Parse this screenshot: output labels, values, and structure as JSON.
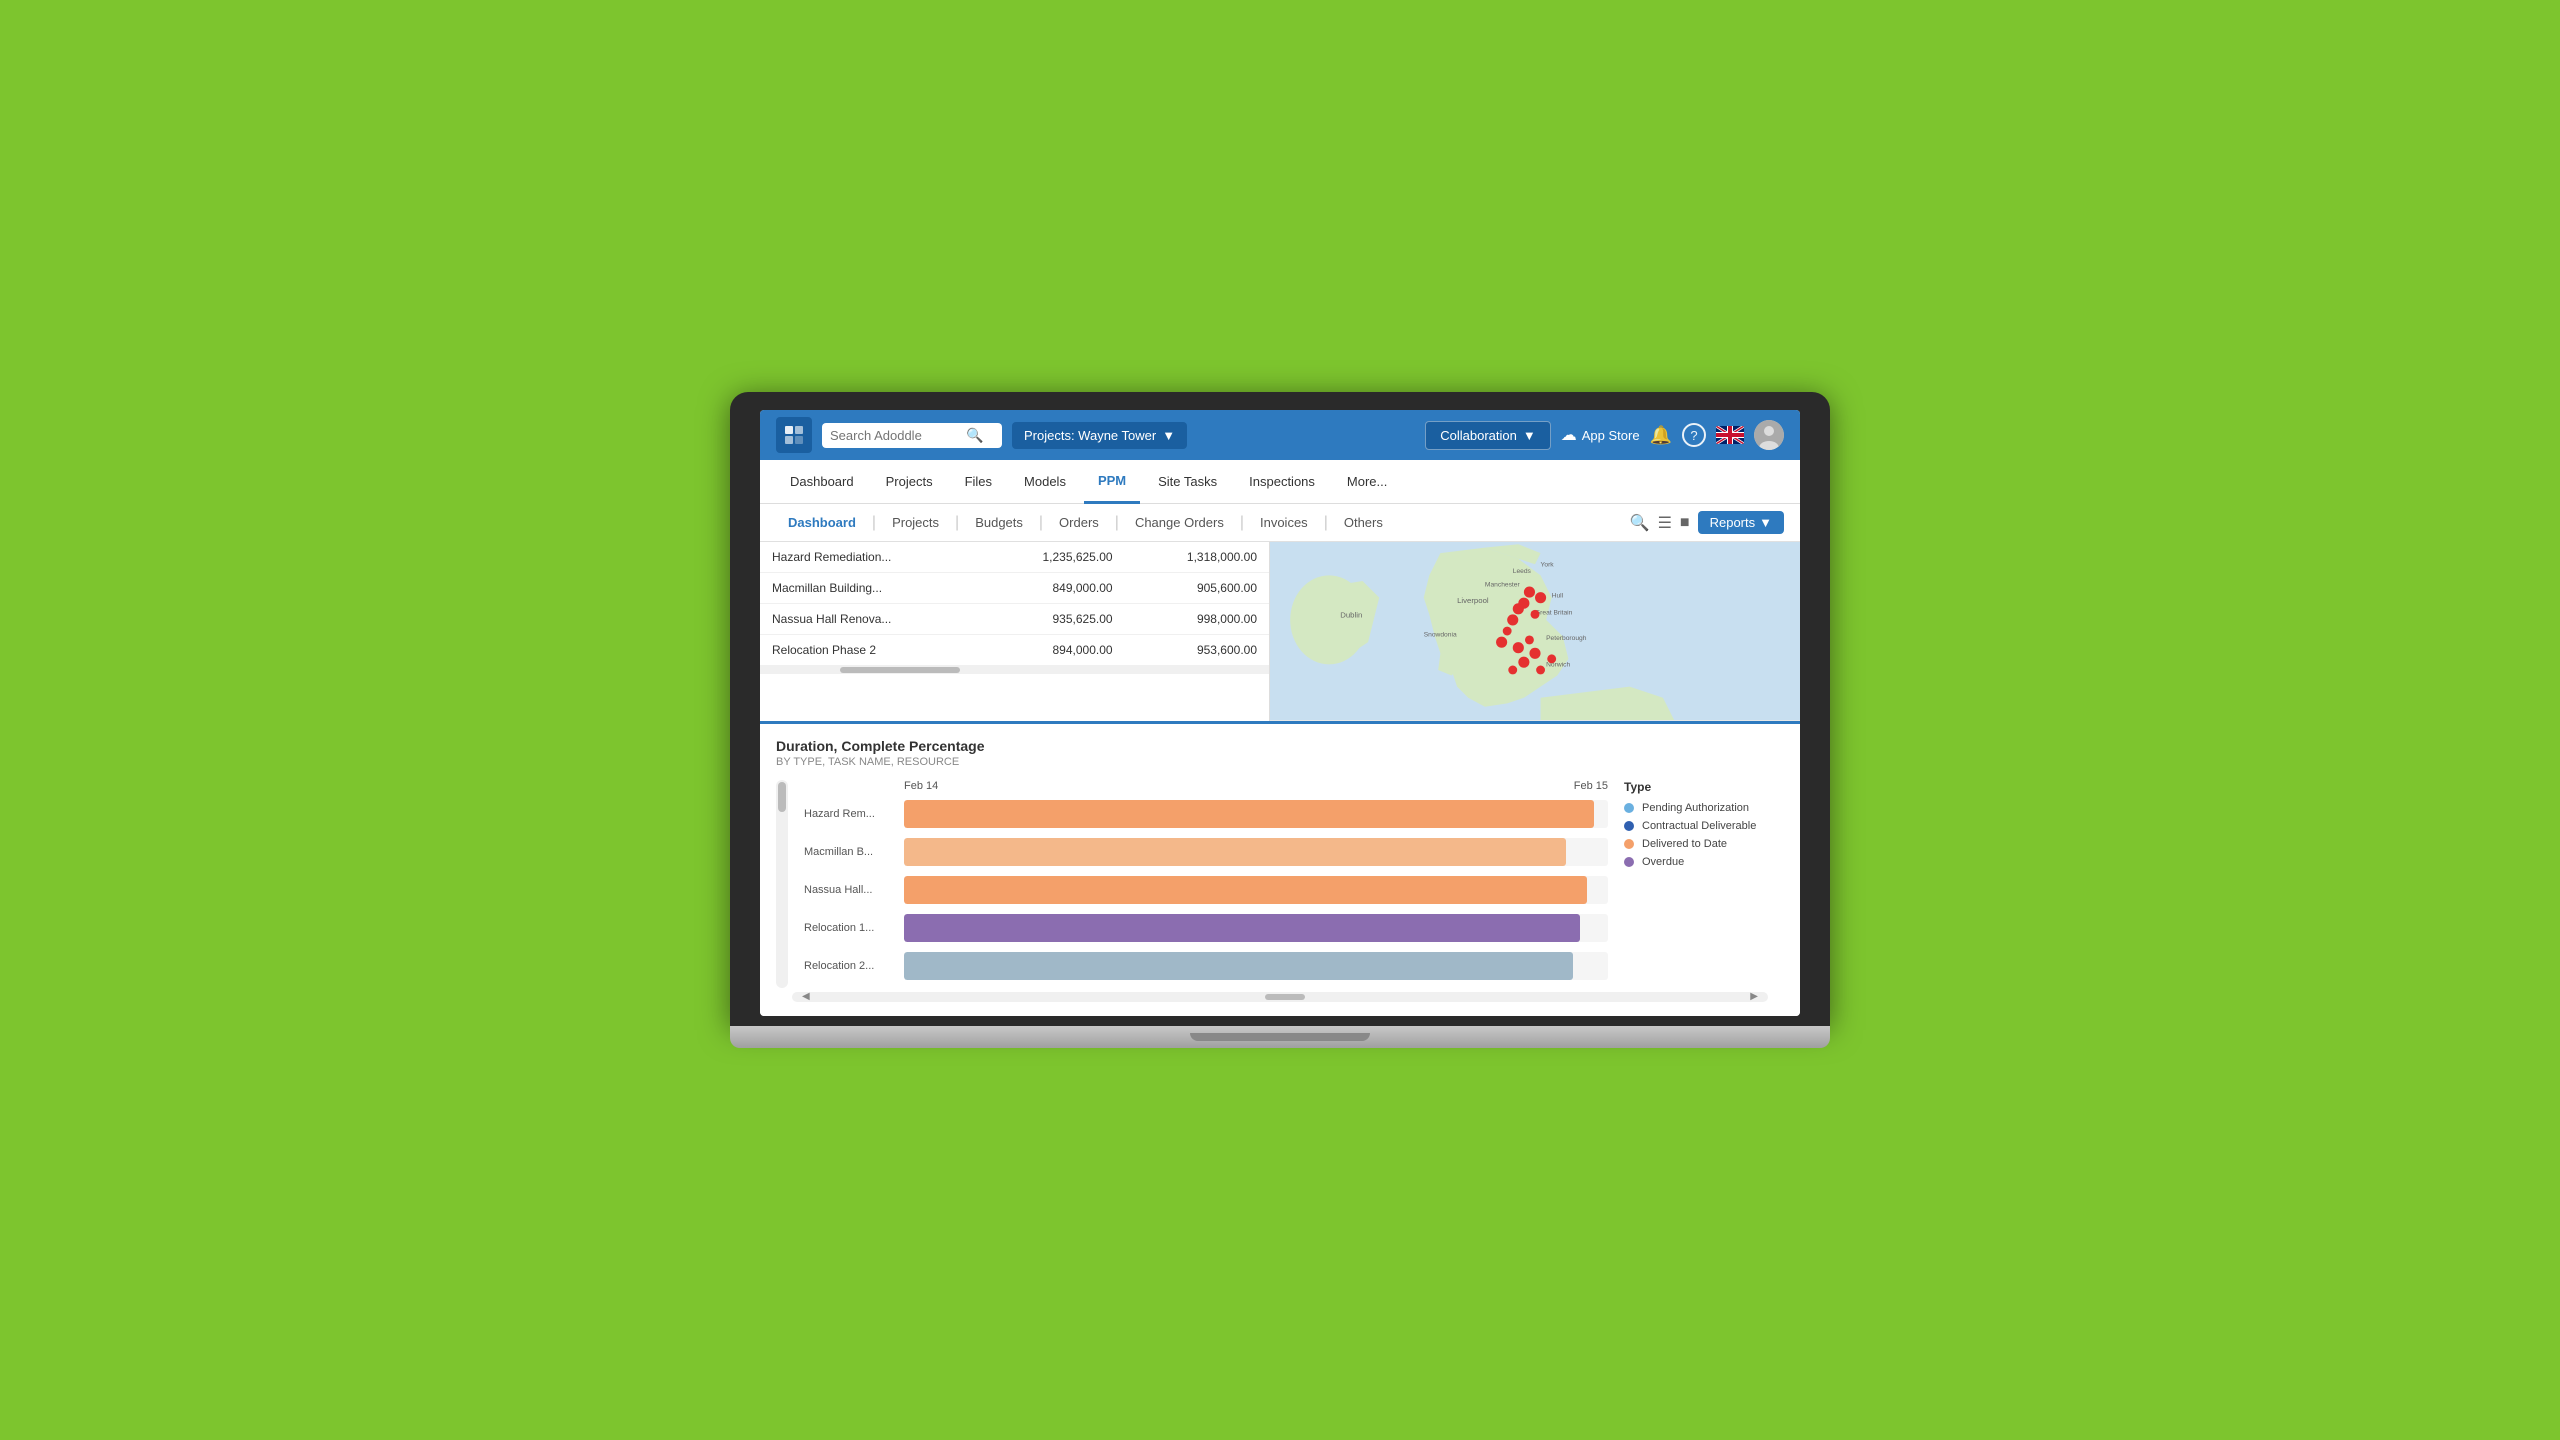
{
  "app": {
    "logo": "A",
    "search_placeholder": "Search Adoddle",
    "project_label": "Projects: Wayne Tower",
    "collaboration_label": "Collaboration",
    "appstore_label": "App Store"
  },
  "nav": {
    "items": [
      {
        "label": "Dashboard",
        "active": false
      },
      {
        "label": "Projects",
        "active": false
      },
      {
        "label": "Files",
        "active": false
      },
      {
        "label": "Models",
        "active": false
      },
      {
        "label": "PPM",
        "active": true
      },
      {
        "label": "Site Tasks",
        "active": false
      },
      {
        "label": "Inspections",
        "active": false
      },
      {
        "label": "More...",
        "active": false
      }
    ]
  },
  "subnav": {
    "items": [
      {
        "label": "Dashboard",
        "active": true
      },
      {
        "label": "Projects",
        "active": false
      },
      {
        "label": "Budgets",
        "active": false
      },
      {
        "label": "Orders",
        "active": false
      },
      {
        "label": "Change Orders",
        "active": false
      },
      {
        "label": "Invoices",
        "active": false
      },
      {
        "label": "Others",
        "active": false
      }
    ],
    "reports_label": "Reports"
  },
  "table": {
    "rows": [
      {
        "name": "Hazard Remediation...",
        "col2": "1,235,625.00",
        "col3": "1,318,000.00"
      },
      {
        "name": "Macmillan Building...",
        "col2": "849,000.00",
        "col3": "905,600.00"
      },
      {
        "name": "Nassua Hall Renova...",
        "col2": "935,625.00",
        "col3": "998,000.00"
      },
      {
        "name": "Relocation Phase 2",
        "col2": "894,000.00",
        "col3": "953,600.00"
      }
    ]
  },
  "gantt": {
    "title": "Duration, Complete Percentage",
    "subtitle": "BY TYPE, TASK NAME, RESOURCE",
    "date_start": "Feb 14",
    "date_end": "Feb 15",
    "rows": [
      {
        "label": "Hazard Rem...",
        "bar_color": "bar-orange",
        "width_pct": 98
      },
      {
        "label": "Macmillan B...",
        "bar_color": "bar-orange-light",
        "width_pct": 94
      },
      {
        "label": "Nassua Hall...",
        "bar_color": "bar-orange",
        "width_pct": 97
      },
      {
        "label": "Relocation 1...",
        "bar_color": "bar-purple",
        "width_pct": 96
      },
      {
        "label": "Relocation 2...",
        "bar_color": "bar-blue-gray",
        "width_pct": 95
      }
    ],
    "legend": {
      "title": "Type",
      "items": [
        {
          "label": "Pending Authorization",
          "color": "#6ab0e0"
        },
        {
          "label": "Contractual Deliverable",
          "color": "#3060b0"
        },
        {
          "label": "Delivered to Date",
          "color": "#f4a06a"
        },
        {
          "label": "Overdue",
          "color": "#8b6db0"
        }
      ]
    }
  }
}
